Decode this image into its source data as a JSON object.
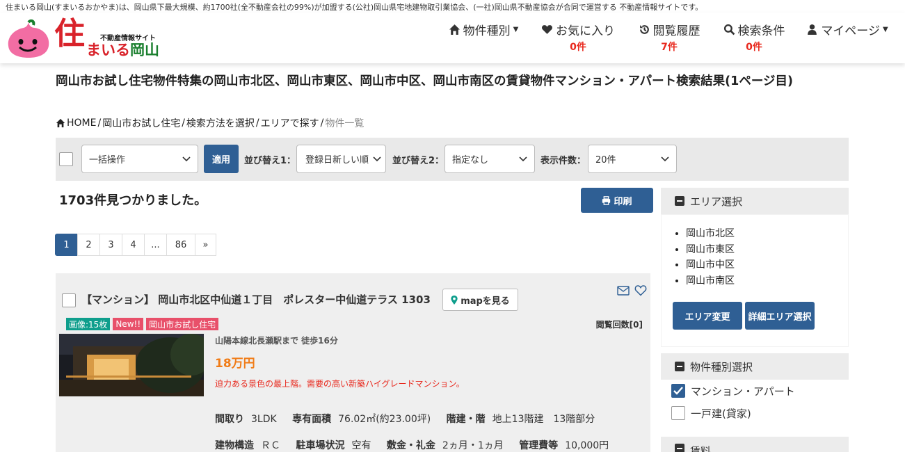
{
  "site_tagline": "住まいる岡山(すまいるおかやま)は、岡山県下最大規模、約1700社(全不動産会社の99%)が加盟する(公社)岡山県宅地建物取引業協会、(一社)岡山県不動産協会が合同で運営する 不動産情報サイトです。",
  "logo": {
    "subtitle": "不動産情報サイト",
    "kanji": "住",
    "main_a": "まいる",
    "main_b": "岡山"
  },
  "nav": {
    "property_type": "物件種別",
    "favorites": "お気に入り",
    "favorites_count": "0件",
    "history": "閲覧履歴",
    "history_count": "7件",
    "search_conditions": "検索条件",
    "search_count": "0件",
    "mypage": "マイページ"
  },
  "page_title": "岡山市お試し住宅物件特集の岡山市北区、岡山市東区、岡山市中区、岡山市南区の賃貸物件マンション・アパート検索結果(1ページ目)",
  "breadcrumb": {
    "home": "HOME",
    "sep": "/",
    "items": [
      "岡山市お試し住宅",
      "検索方法を選択",
      "エリアで探す"
    ],
    "current": "物件一覧"
  },
  "toolbar": {
    "bulk_action": "一括操作",
    "apply": "適用",
    "sort1_label": "並び替え1：",
    "sort1_value": "登録日新しい順",
    "sort2_label": "並び替え2：",
    "sort2_value": "指定なし",
    "per_page_label": "表示件数：",
    "per_page_value": "20件"
  },
  "results": {
    "found": "1703件見つかりました。",
    "print": "印刷"
  },
  "pager": {
    "pages": [
      "1",
      "2",
      "3",
      "4",
      "...",
      "86",
      "»"
    ]
  },
  "listing": {
    "title": "【マンション】 岡山市北区中仙道１丁目　ポレスター中仙道テラス 1303",
    "map_button": "mapを見る",
    "tags": [
      "画像:15枚",
      "New!!",
      "岡山市お試し住宅"
    ],
    "tag_colors": [
      "#0e9e8c",
      "#e8506a",
      "#e8506a"
    ],
    "views": "閲覧回数[0]",
    "station": "山陽本線北長瀬駅まで 徒歩16分",
    "price": "18万円",
    "catch_copy": "迫力ある景色の最上階。需要の高い新築ハイグレードマンション。",
    "spec_row1": [
      {
        "label": "間取り",
        "value": "3LDK"
      },
      {
        "label": "専有面積",
        "value": "76.02㎡(約23.00坪)"
      },
      {
        "label": "階建・階",
        "value": "地上13階建　13階部分"
      }
    ],
    "spec_row2": [
      {
        "label": "建物構造",
        "value": "ＲＣ"
      },
      {
        "label": "駐車場状況",
        "value": "空有"
      },
      {
        "label": "敷金・礼金",
        "value": "2ヵ月・1ヵ月"
      },
      {
        "label": "管理費等",
        "value": "10,000円"
      }
    ]
  },
  "sidebar": {
    "area_title": "エリア選択",
    "areas": [
      "岡山市北区",
      "岡山市東区",
      "岡山市中区",
      "岡山市南区"
    ],
    "area_change": "エリア変更",
    "area_detail": "詳細エリア選択",
    "type_title": "物件種別選択",
    "types": [
      {
        "label": "マンション・アパート",
        "checked": true
      },
      {
        "label": "一戸建(貸家)",
        "checked": false
      }
    ],
    "rent_title": "賃料"
  },
  "colors": {
    "accent": "#2f5f94",
    "count_red": "#e8281d",
    "price_orange": "#f07c17"
  }
}
